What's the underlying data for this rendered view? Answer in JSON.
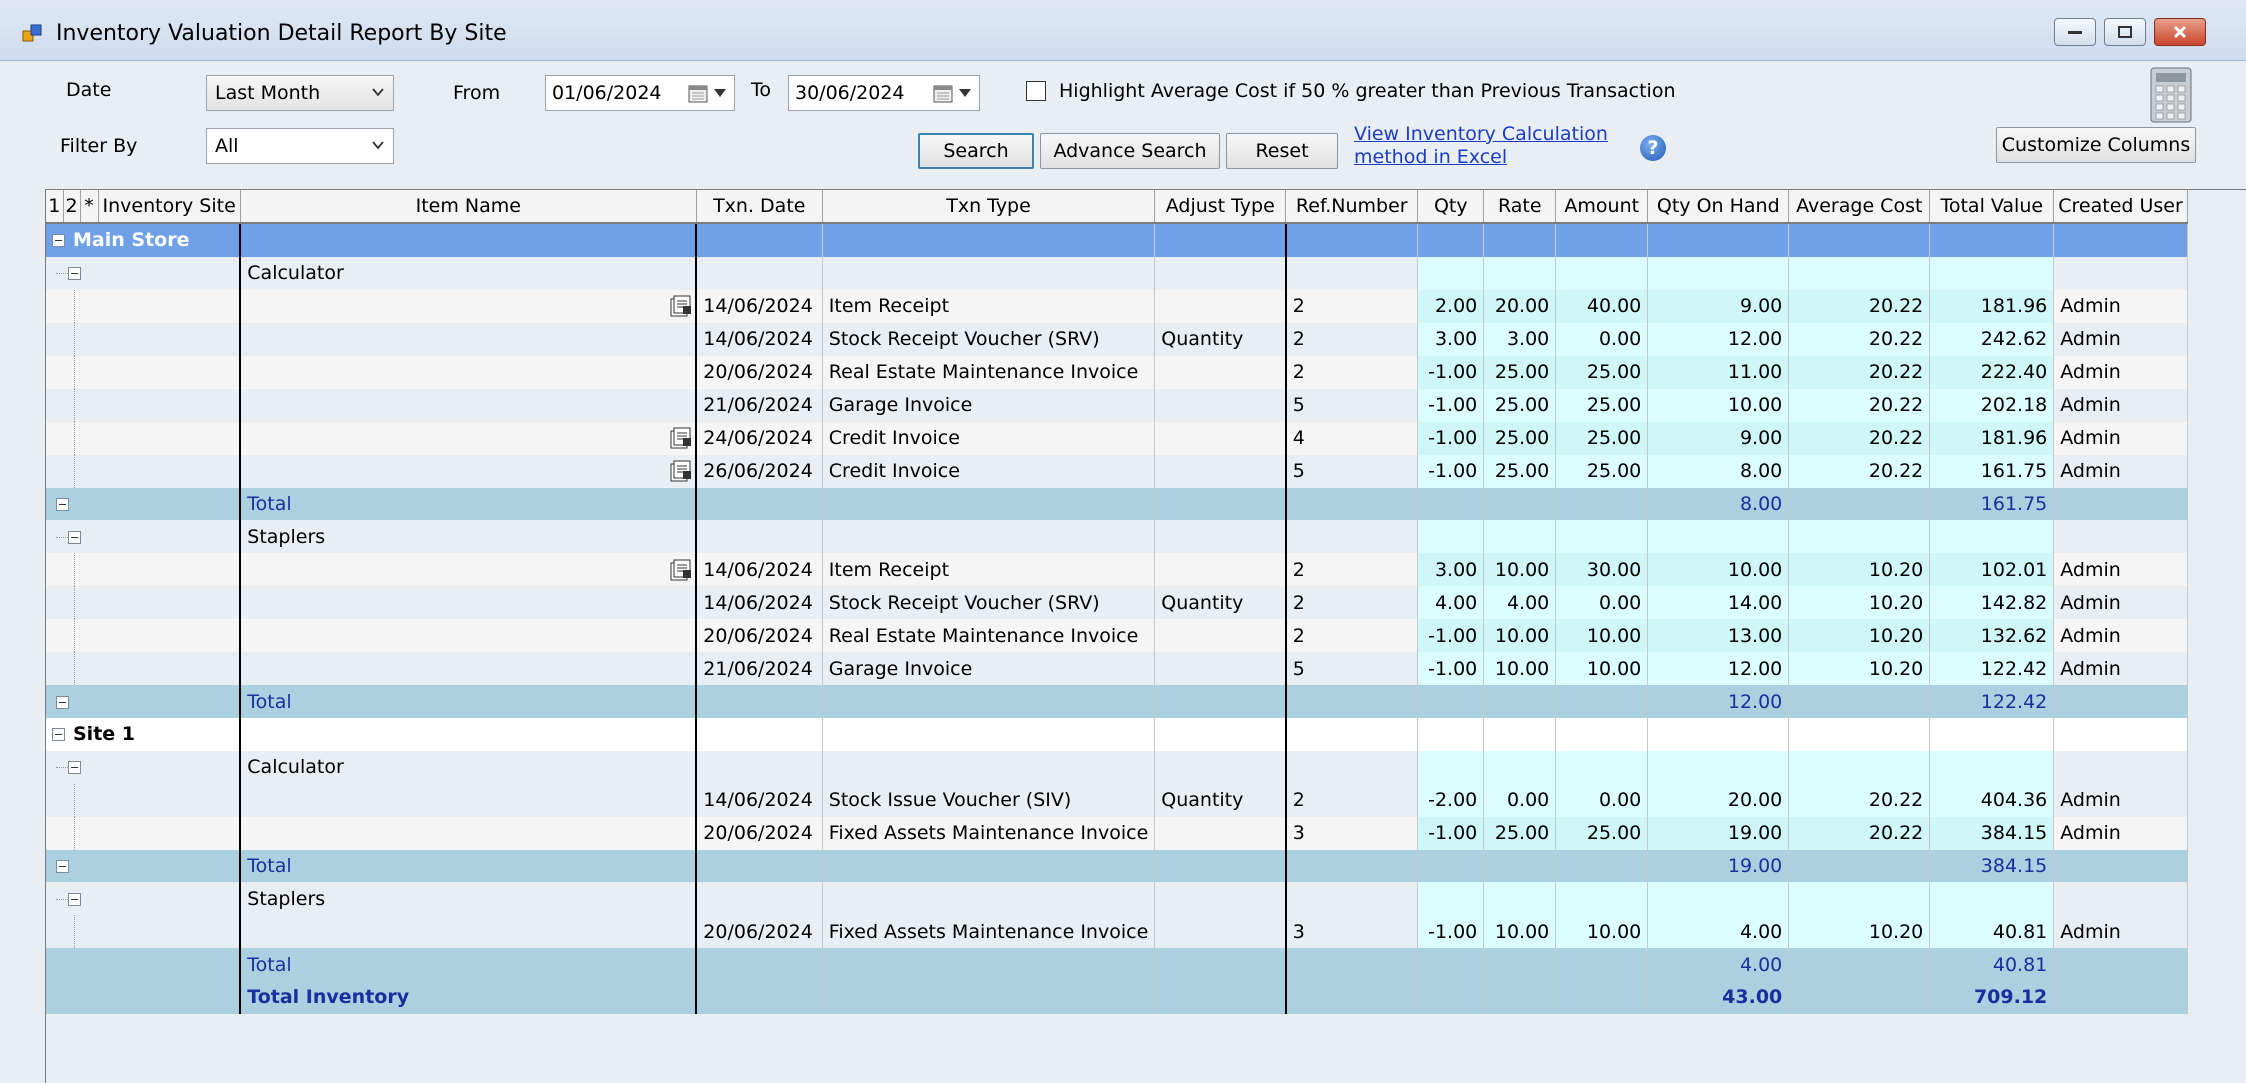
{
  "window": {
    "title": "Inventory Valuation Detail Report By Site"
  },
  "filters": {
    "date_label": "Date",
    "date_value": "Last Month",
    "from_label": "From",
    "from_value": "01/06/2024",
    "to_label": "To",
    "to_value": "30/06/2024",
    "highlight_label": "Highlight Average Cost if 50 % greater than Previous Transaction",
    "highlight_checked": false,
    "filter_by_label": "Filter By",
    "filter_by_value": "All"
  },
  "toolbar": {
    "search": "Search",
    "advance_search": "Advance Search",
    "reset": "Reset",
    "link_line1": "View Inventory Calculation",
    "link_line2": "method in Excel",
    "customize": "Customize Columns"
  },
  "columns": [
    "1",
    "2",
    "*",
    "Inventory Site",
    "Item Name",
    "Txn. Date",
    "Txn Type",
    "Adjust Type",
    "Ref.Number",
    "Qty",
    "Rate",
    "Amount",
    "Qty On Hand",
    "Average Cost",
    "Total Value",
    "Created User"
  ],
  "rows": [
    {
      "kind": "group",
      "site": "Main Store"
    },
    {
      "kind": "item",
      "item": "Calculator"
    },
    {
      "kind": "txn",
      "icon": true,
      "date": "14/06/2024",
      "type": "Item Receipt",
      "adjust": "",
      "ref": "2",
      "qty": "2.00",
      "rate": "20.00",
      "amount": "40.00",
      "onhand": "9.00",
      "avg": "20.22",
      "total": "181.96",
      "user": "Admin"
    },
    {
      "kind": "txn",
      "icon": false,
      "date": "14/06/2024",
      "type": "Stock Receipt Voucher (SRV)",
      "adjust": "Quantity",
      "ref": "2",
      "qty": "3.00",
      "rate": "3.00",
      "amount": "0.00",
      "onhand": "12.00",
      "avg": "20.22",
      "total": "242.62",
      "user": "Admin"
    },
    {
      "kind": "txn",
      "icon": false,
      "date": "20/06/2024",
      "type": "Real Estate Maintenance Invoice",
      "adjust": "",
      "ref": "2",
      "qty": "-1.00",
      "rate": "25.00",
      "amount": "25.00",
      "onhand": "11.00",
      "avg": "20.22",
      "total": "222.40",
      "user": "Admin"
    },
    {
      "kind": "txn",
      "icon": false,
      "date": "21/06/2024",
      "type": "Garage Invoice",
      "adjust": "",
      "ref": "5",
      "qty": "-1.00",
      "rate": "25.00",
      "amount": "25.00",
      "onhand": "10.00",
      "avg": "20.22",
      "total": "202.18",
      "user": "Admin"
    },
    {
      "kind": "txn",
      "icon": true,
      "date": "24/06/2024",
      "type": "Credit Invoice",
      "adjust": "",
      "ref": "4",
      "qty": "-1.00",
      "rate": "25.00",
      "amount": "25.00",
      "onhand": "9.00",
      "avg": "20.22",
      "total": "181.96",
      "user": "Admin"
    },
    {
      "kind": "txn",
      "icon": true,
      "date": "26/06/2024",
      "type": "Credit Invoice",
      "adjust": "",
      "ref": "5",
      "qty": "-1.00",
      "rate": "25.00",
      "amount": "25.00",
      "onhand": "8.00",
      "avg": "20.22",
      "total": "161.75",
      "user": "Admin"
    },
    {
      "kind": "total",
      "label": "Total",
      "onhand": "8.00",
      "total": "161.75"
    },
    {
      "kind": "item",
      "item": "Staplers"
    },
    {
      "kind": "txn",
      "icon": true,
      "date": "14/06/2024",
      "type": "Item Receipt",
      "adjust": "",
      "ref": "2",
      "qty": "3.00",
      "rate": "10.00",
      "amount": "30.00",
      "onhand": "10.00",
      "avg": "10.20",
      "total": "102.01",
      "user": "Admin"
    },
    {
      "kind": "txn",
      "icon": false,
      "date": "14/06/2024",
      "type": "Stock Receipt Voucher (SRV)",
      "adjust": "Quantity",
      "ref": "2",
      "qty": "4.00",
      "rate": "4.00",
      "amount": "0.00",
      "onhand": "14.00",
      "avg": "10.20",
      "total": "142.82",
      "user": "Admin"
    },
    {
      "kind": "txn",
      "icon": false,
      "date": "20/06/2024",
      "type": "Real Estate Maintenance Invoice",
      "adjust": "",
      "ref": "2",
      "qty": "-1.00",
      "rate": "10.00",
      "amount": "10.00",
      "onhand": "13.00",
      "avg": "10.20",
      "total": "132.62",
      "user": "Admin"
    },
    {
      "kind": "txn",
      "icon": false,
      "date": "21/06/2024",
      "type": "Garage Invoice",
      "adjust": "",
      "ref": "5",
      "qty": "-1.00",
      "rate": "10.00",
      "amount": "10.00",
      "onhand": "12.00",
      "avg": "10.20",
      "total": "122.42",
      "user": "Admin"
    },
    {
      "kind": "total",
      "label": "Total",
      "onhand": "12.00",
      "total": "122.42"
    },
    {
      "kind": "site",
      "site": "Site 1"
    },
    {
      "kind": "item",
      "item": "Calculator"
    },
    {
      "kind": "txn",
      "icon": false,
      "date": "14/06/2024",
      "type": "Stock Issue Voucher (SIV)",
      "adjust": "Quantity",
      "ref": "2",
      "qty": "-2.00",
      "rate": "0.00",
      "amount": "0.00",
      "onhand": "20.00",
      "avg": "20.22",
      "total": "404.36",
      "user": "Admin"
    },
    {
      "kind": "txn",
      "icon": false,
      "date": "20/06/2024",
      "type": "Fixed Assets Maintenance Invoice",
      "adjust": "",
      "ref": "3",
      "qty": "-1.00",
      "rate": "25.00",
      "amount": "25.00",
      "onhand": "19.00",
      "avg": "20.22",
      "total": "384.15",
      "user": "Admin"
    },
    {
      "kind": "total",
      "label": "Total",
      "onhand": "19.00",
      "total": "384.15"
    },
    {
      "kind": "item",
      "item": "Staplers"
    },
    {
      "kind": "txn",
      "icon": false,
      "date": "20/06/2024",
      "type": "Fixed Assets Maintenance Invoice",
      "adjust": "",
      "ref": "3",
      "qty": "-1.00",
      "rate": "10.00",
      "amount": "10.00",
      "onhand": "4.00",
      "avg": "10.20",
      "total": "40.81",
      "user": "Admin"
    },
    {
      "kind": "total",
      "label": "Total",
      "onhand": "4.00",
      "total": "40.81",
      "nominus": true
    },
    {
      "kind": "grand",
      "label": "Total Inventory",
      "onhand": "43.00",
      "total": "709.12"
    }
  ]
}
